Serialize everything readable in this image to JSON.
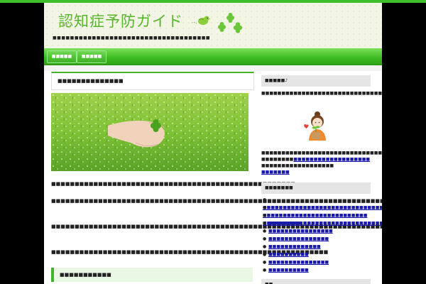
{
  "site": {
    "title": "認知症予防ガイド",
    "tagline": "■■■■■■■■■■■■■■■■■■■■■■■■■■■■■■■■■■■■"
  },
  "nav": [
    {
      "label": "■■■■■"
    },
    {
      "label": "■■■■■"
    }
  ],
  "post": {
    "title": "■■■■■■■■■■■■■■",
    "paragraphs": [
      "■■■■■■■■■■■■■■■■■■■■■■■■■■■■■■■■■■■■■■■■■■■■■■■■■■■■",
      "■■■■■■■■■■■■■■■■■■■■■■■■■■■■■■■■■■■■■■■■■■■■■■■■■■■■■■■■■■■■■■■■■■■■■■■■■■■■■■■■",
      "■■■■■■■■■■■■■■■■■■■■■■■■■■■■■■■■■■■■■■■■■■■■■■■■■■■■■■■■■■■■■■■■■■■■■■■■■■■■■■■■■■■",
      "■■■■■■■■■■■■■■■■■■■■■■■■■■■■■■■■■■■■■■■■■■■■■■■■■■■■■■■■■■■"
    ],
    "subheading": "■■■■■■■■■■■"
  },
  "sidebar": {
    "profile_title": "■■■■■♪",
    "profile_text": "■■■■■■■■■■■■■■■■■■■■■■■■■■■■■■■■■■■■■■■■■■■■■■■■■■■■■■■■■■■■■■■■■■■■■■■■■■■■■",
    "profile_line1": "■■■■■■■■■■■■■■■■■■■■■■■■■■■■■■■",
    "profile_line2_text": "■■■■■■■■",
    "profile_line2_link": "■■■■■■■■■■■■■■■■■■■",
    "profile_line3": "■■■■■■■■■■■■■■■■■■",
    "profile_link": "■■■■■■■",
    "list_title": "■■■■■■■",
    "list_bullet": "●",
    "list": [
      "■■■■■■■■■■■■■■■■■■■■■■■■■■■■■■■■",
      "■■■■■■■■■■■■■■■■■■■■■■■■■■",
      "■■■■■■■■■■■■■■■■■■■■■■■■■■■■■■■■",
      "■■■■■■■■",
      "■■■■■■■■■■■■■■■■",
      "■■■■■■■■■■■■■■■",
      "■■■■■■■■■■■■■",
      "■■■■■■■■■■",
      "■■■■■■■■■■■■■■■",
      "■■■■■■■■■■"
    ],
    "bottom_title": "■■"
  }
}
